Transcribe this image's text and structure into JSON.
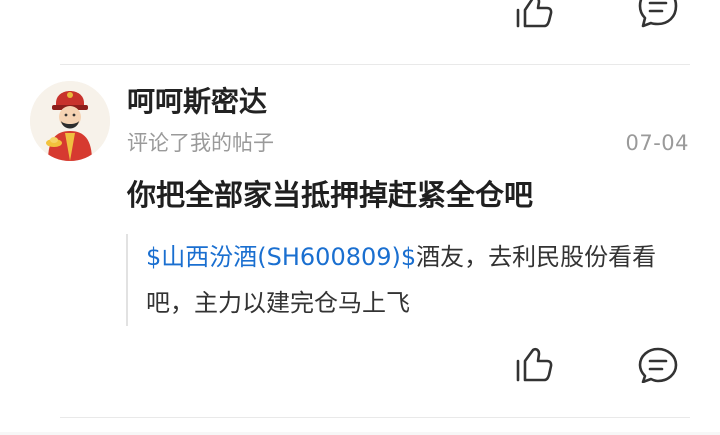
{
  "top_actions": {
    "like_icon": "thumbs-up-icon",
    "comment_icon": "comment-icon"
  },
  "post": {
    "user": {
      "name": "呵呵斯密达",
      "avatar_icon": "fortune-god-avatar"
    },
    "action_text": "评论了我的帖子",
    "date": "07-04",
    "comment": "你把全部家当抵押掉赶紧全仓吧",
    "quote": {
      "stock_tag": "$山西汾酒(SH600809)$",
      "text": "酒友，去利民股份看看吧，主力以建完仓马上飞"
    },
    "actions": {
      "like_icon": "thumbs-up-icon",
      "comment_icon": "comment-icon"
    }
  },
  "colors": {
    "link": "#1a6fd0",
    "primary_text": "#222222",
    "secondary_text": "#9a9a9a",
    "divider": "#e9e9e9"
  }
}
